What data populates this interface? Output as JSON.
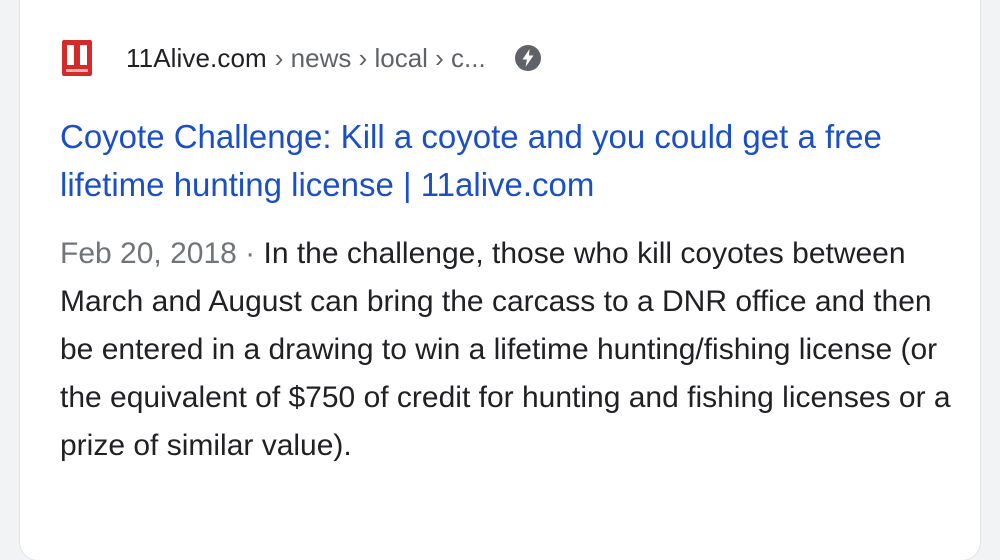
{
  "result": {
    "site_name": "11Alive.com",
    "breadcrumb": "› news › local › c...",
    "favicon_icon": "11alive-logo-icon",
    "amp_icon": "lightning-bolt-icon",
    "title": "Coyote Challenge: Kill a coyote and you could get a free lifetime hunting license | 11alive.com",
    "date": "Feb 20, 2018",
    "separator": " · ",
    "snippet": "In the challenge, those who kill coyotes between March and August can bring the carcass to a DNR office and then be entered in a drawing to win a lifetime hunting/fishing license (or the equivalent of $750 of credit for hunting and fishing licenses or a prize of similar value).",
    "colors": {
      "title_link": "#1a4fc7",
      "favicon_red": "#d42a2a",
      "date_gray": "#70757a",
      "text": "#202124"
    }
  }
}
